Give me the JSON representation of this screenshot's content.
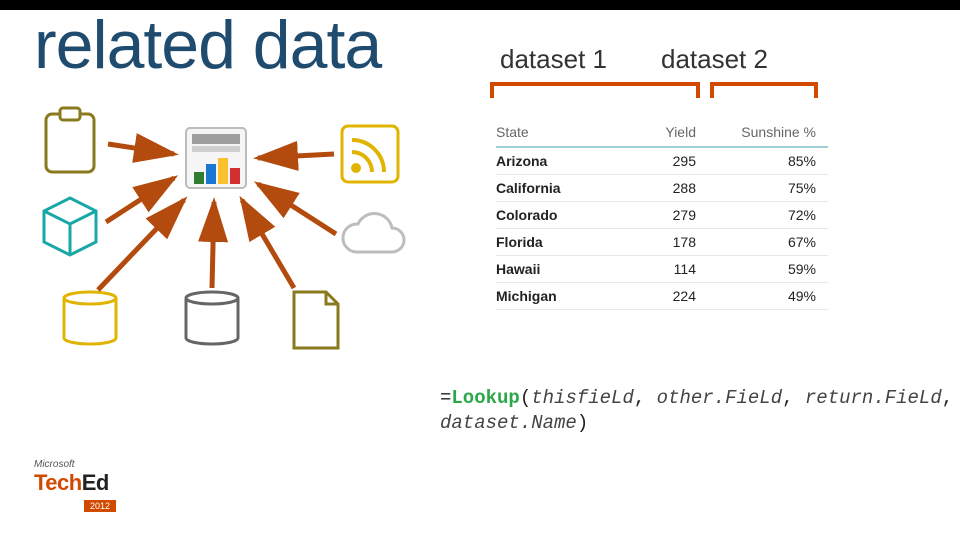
{
  "title": "related data",
  "labels": {
    "d1": "dataset 1",
    "d2": "dataset 2"
  },
  "table": {
    "headers": {
      "c1": "State",
      "c2": "Yield",
      "c3": "Sunshine %"
    },
    "rows": [
      {
        "c1": "Arizona",
        "c2": "295",
        "c3": "85%"
      },
      {
        "c1": "California",
        "c2": "288",
        "c3": "75%"
      },
      {
        "c1": "Colorado",
        "c2": "279",
        "c3": "72%"
      },
      {
        "c1": "Florida",
        "c2": "178",
        "c3": "67%"
      },
      {
        "c1": "Hawaii",
        "c2": "114",
        "c3": "59%"
      },
      {
        "c1": "Michigan",
        "c2": "224",
        "c3": "49%"
      }
    ]
  },
  "formula": {
    "eq": "=",
    "fn": "Lookup",
    "open": "(",
    "a1": "thisfieLd",
    "sep": ", ",
    "a2": "other.FieLd",
    "a3": "return.FieLd",
    "a4": "dataset.Name",
    "close": ")"
  },
  "logo": {
    "ms": "Microsoft",
    "brand_t": "Tech",
    "brand_e": "Ed",
    "year": "2012"
  },
  "chart_data": {
    "type": "table",
    "title": "related data",
    "datasets": [
      {
        "name": "dataset 1",
        "columns": [
          "State",
          "Yield"
        ]
      },
      {
        "name": "dataset 2",
        "columns": [
          "Sunshine %"
        ]
      }
    ],
    "rows": [
      {
        "State": "Arizona",
        "Yield": 295,
        "Sunshine %": 85
      },
      {
        "State": "California",
        "Yield": 288,
        "Sunshine %": 75
      },
      {
        "State": "Colorado",
        "Yield": 279,
        "Sunshine %": 72
      },
      {
        "State": "Florida",
        "Yield": 178,
        "Sunshine %": 67
      },
      {
        "State": "Hawaii",
        "Yield": 114,
        "Sunshine %": 59
      },
      {
        "State": "Michigan",
        "Yield": 224,
        "Sunshine %": 49
      }
    ]
  }
}
